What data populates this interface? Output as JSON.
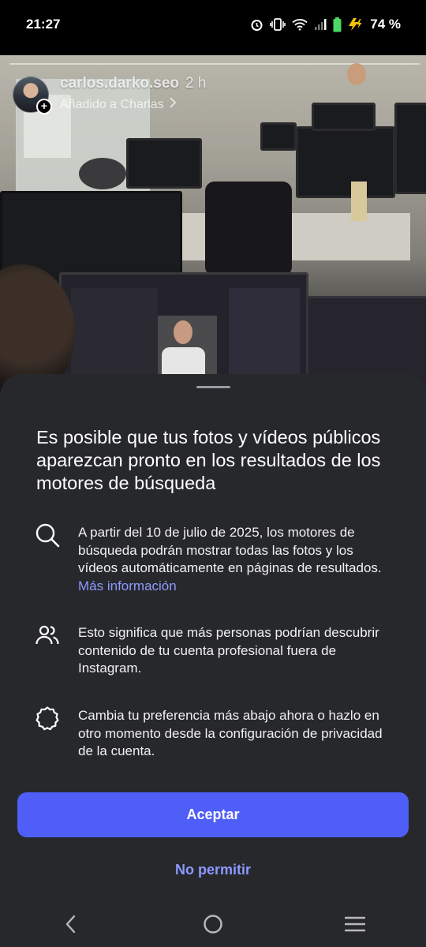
{
  "status_bar": {
    "time": "21:27",
    "battery_percent": "74 %",
    "icons": [
      "alarm-icon",
      "vibrate-icon",
      "wifi-icon",
      "signal-icon",
      "battery-icon",
      "charging-icon"
    ]
  },
  "story": {
    "username": "carlos.darko.seo",
    "time_ago": "2 h",
    "added_to": "Añadido a Charlas"
  },
  "sheet": {
    "title": "Es posible que tus fotos y vídeos públicos aparezcan pronto en los resultados de los motores de búsqueda",
    "items": [
      {
        "icon": "search-icon",
        "text": "A partir del 10 de julio de 2025, los motores de búsqueda podrán mostrar todas las fotos y los vídeos automáticamente en páginas de resultados.",
        "link": "Más información"
      },
      {
        "icon": "people-icon",
        "text": "Esto significa que más personas podrían descubrir contenido de tu cuenta profesional fuera de Instagram."
      },
      {
        "icon": "settings-gear-icon",
        "text": "Cambia tu preferencia más abajo ahora o hazlo en otro momento desde la configuración de privacidad de la cuenta."
      }
    ],
    "accept_label": "Aceptar",
    "deny_label": "No permitir"
  },
  "nav": {
    "icons": [
      "back-icon",
      "home-icon",
      "recents-icon"
    ]
  },
  "colors": {
    "sheet_background": "#27282c",
    "accent": "#4f5ef6",
    "link": "#8d99ff"
  }
}
